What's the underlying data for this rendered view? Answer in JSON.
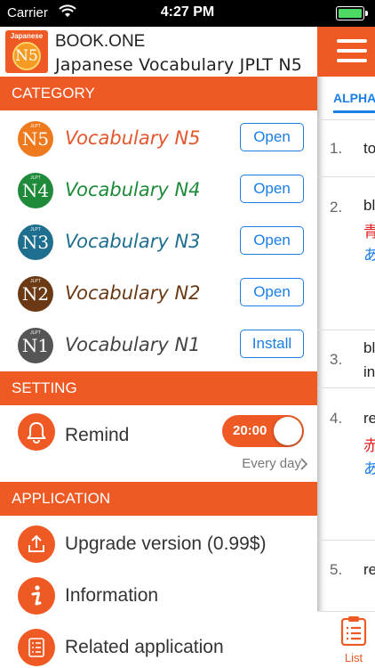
{
  "status_bar": {
    "carrier": "Carrier",
    "time": "4:27 PM"
  },
  "header": {
    "logo_top": "Japanese",
    "logo_level": "N5",
    "title": "BOOK.ONE",
    "subtitle": "Japanese Vocabulary JPLT N5"
  },
  "category": {
    "header": "CATEGORY",
    "items": [
      {
        "badge": "N5",
        "badge_small": "JLPT",
        "label": "Vocabulary N5",
        "button": "Open",
        "color": "#ef7a1e",
        "label_color": "#e4572e"
      },
      {
        "badge": "N4",
        "badge_small": "JLPT",
        "label": "Vocabulary N4",
        "button": "Open",
        "color": "#1f8a3a",
        "label_color": "#1f8a3a"
      },
      {
        "badge": "N3",
        "badge_small": "JLPT",
        "label": "Vocabulary N3",
        "button": "Open",
        "color": "#1e6f8f",
        "label_color": "#1e6f8f"
      },
      {
        "badge": "N2",
        "badge_small": "JLPT",
        "label": "Vocabulary N2",
        "button": "Open",
        "color": "#6b3a14",
        "label_color": "#6b3a14"
      },
      {
        "badge": "N1",
        "badge_small": "JLPT",
        "label": "Vocabulary N1",
        "button": "Install",
        "color": "#555555",
        "label_color": "#444444"
      }
    ]
  },
  "setting": {
    "header": "SETTING",
    "remind_label": "Remind",
    "remind_time": "20:00",
    "remind_on": true,
    "frequency": "Every day"
  },
  "application": {
    "header": "APPLICATION",
    "items": [
      {
        "label": "Upgrade version (0.99$)",
        "icon": "upload-icon"
      },
      {
        "label": "Information",
        "icon": "info-icon"
      },
      {
        "label": "Related application",
        "icon": "list-icon"
      }
    ]
  },
  "main": {
    "tab_label": "ALPHA",
    "items": [
      {
        "num": "1.",
        "word": "to",
        "kanji": "",
        "kana": ""
      },
      {
        "num": "2.",
        "word": "bl",
        "kanji": "青",
        "kana": "あ"
      },
      {
        "num": "3.",
        "word": "bl",
        "kanji": "",
        "kana": "",
        "extra": "in"
      },
      {
        "num": "4.",
        "word": "re",
        "kanji": "赤",
        "kana": "あ"
      },
      {
        "num": "5.",
        "word": "re",
        "kanji": "",
        "kana": ""
      }
    ],
    "bottom_tab_label": "List"
  },
  "colors": {
    "accent": "#ef5a24",
    "link": "#1a7ee6"
  }
}
